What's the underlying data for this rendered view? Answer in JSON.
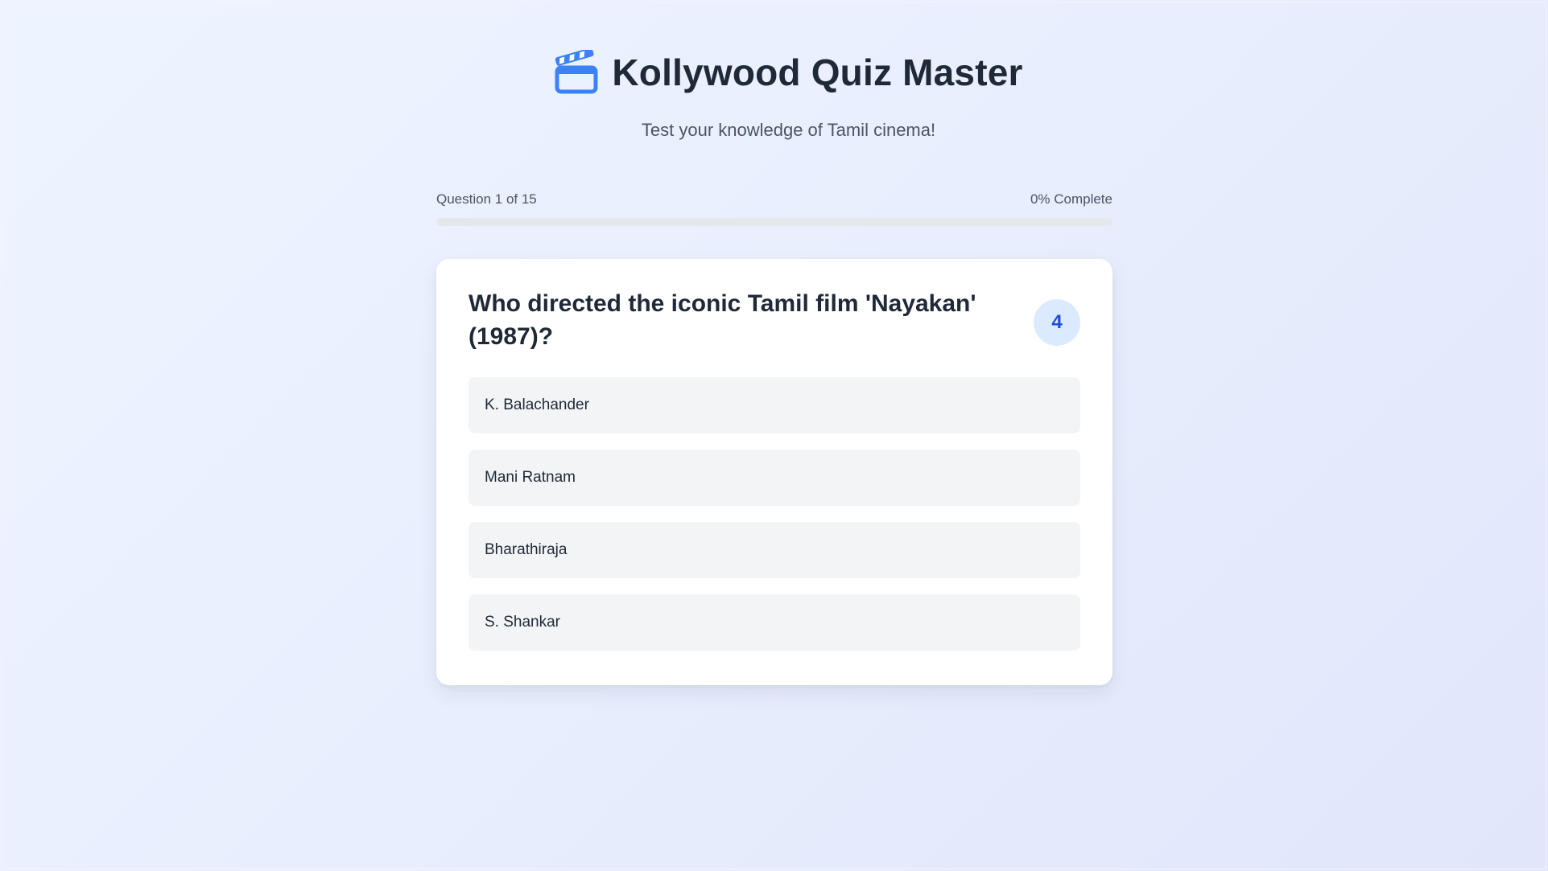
{
  "app": {
    "title": "Kollywood Quiz Master",
    "subtitle": "Test your knowledge of Tamil cinema!",
    "icon": "clapperboard-icon",
    "accent_color": "#3b82f6"
  },
  "progress": {
    "question_label": "Question 1 of 15",
    "complete_label": "0% Complete",
    "percent": 0
  },
  "question": {
    "text": "Who directed the iconic Tamil film 'Nayakan' (1987)?",
    "points": "4",
    "options": [
      {
        "label": "K. Balachander"
      },
      {
        "label": "Mani Ratnam"
      },
      {
        "label": "Bharathiraja"
      },
      {
        "label": "S. Shankar"
      }
    ]
  }
}
